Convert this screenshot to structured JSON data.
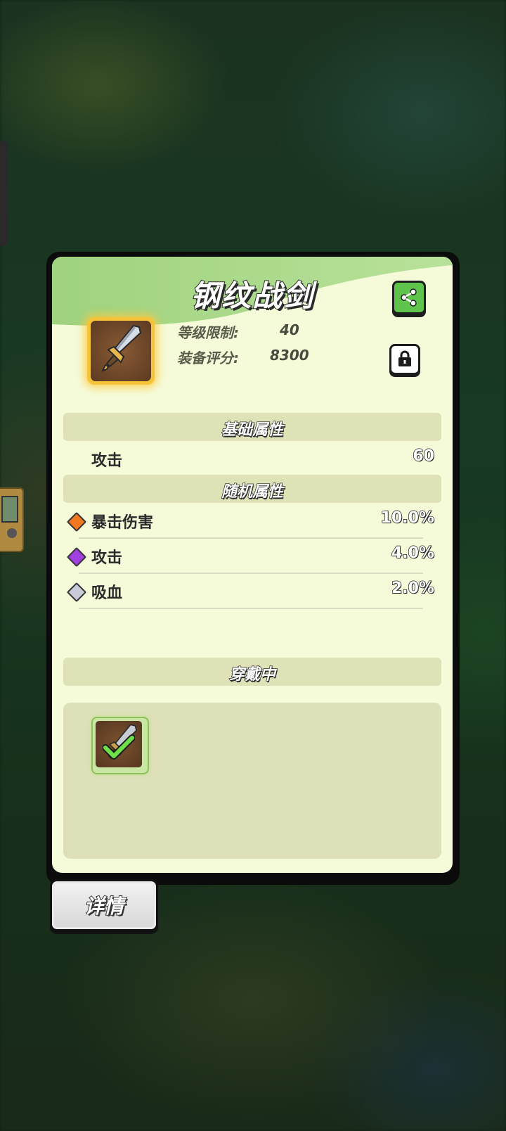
{
  "item": {
    "name": "钢纹战剑",
    "level_label": "等级限制:",
    "level_value": "40",
    "score_label": "装备评分:",
    "score_value": "8300"
  },
  "base_section": {
    "title": "基础属性",
    "stats": [
      {
        "name": "攻击",
        "value": "60"
      }
    ]
  },
  "random_section": {
    "title": "随机属性",
    "stats": [
      {
        "name": "暴击伤害",
        "value": "10.0%",
        "gem_color": "#f07820"
      },
      {
        "name": "攻击",
        "value": "4.0%",
        "gem_color": "#a13fe0"
      },
      {
        "name": "吸血",
        "value": "2.0%",
        "gem_color": "#c9ccd8"
      }
    ]
  },
  "equipped_section": {
    "title": "穿戴中"
  },
  "detail_button": "详情",
  "icons": {
    "share": "share-icon",
    "lock": "lock-icon",
    "sword": "sword-icon",
    "check": "checkmark-icon"
  },
  "colors": {
    "panel_bg": "#f5fbd9",
    "header_green": "#a9d98a",
    "item_frame_gold": "#f6c43a",
    "share_button": "#5ec44c"
  }
}
